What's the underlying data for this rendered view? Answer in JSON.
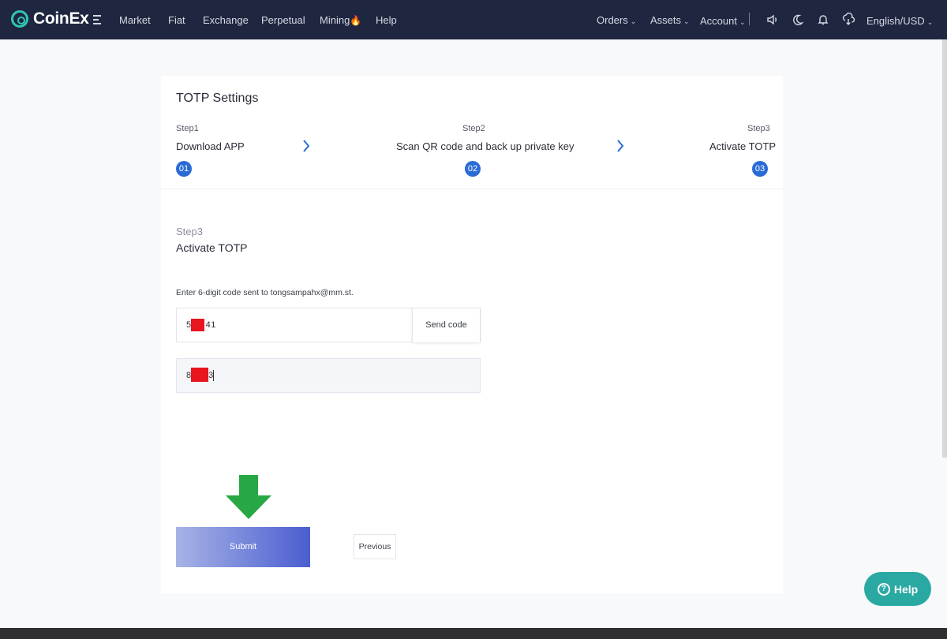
{
  "brand": {
    "name": "CoinEx",
    "accent": "#2fc6b3",
    "nav_bg": "#1f2640",
    "step_color": "#2a6bd6"
  },
  "nav": {
    "left": [
      "Market",
      "Fiat",
      "Exchange",
      "Perpetual",
      "Mining",
      "Help"
    ],
    "right": [
      "Orders",
      "Assets",
      "Account"
    ],
    "language": "English/USD",
    "icons": [
      "menu-icon",
      "flame-icon",
      "sound-icon",
      "moon-icon",
      "bell-icon",
      "download-icon"
    ]
  },
  "page": {
    "title": "TOTP Settings"
  },
  "steps": [
    {
      "small": "Step1",
      "name": "Download APP",
      "num": "01"
    },
    {
      "small": "Step2",
      "name": "Scan QR code and back up private key",
      "num": "02"
    },
    {
      "small": "Step3",
      "name": "Activate TOTP",
      "num": "03"
    }
  ],
  "section": {
    "step": "Step3",
    "title": "Activate TOTP"
  },
  "form": {
    "hint": "Enter 6-digit code sent to tongsampahx@mm.st.",
    "email_code": {
      "prefix": "5",
      "suffix": "41"
    },
    "send_label": "Send code",
    "totp_code": {
      "prefix": "8",
      "suffix": "3"
    }
  },
  "actions": {
    "submit": "Submit",
    "previous": "Previous"
  },
  "help_fab": "Help"
}
